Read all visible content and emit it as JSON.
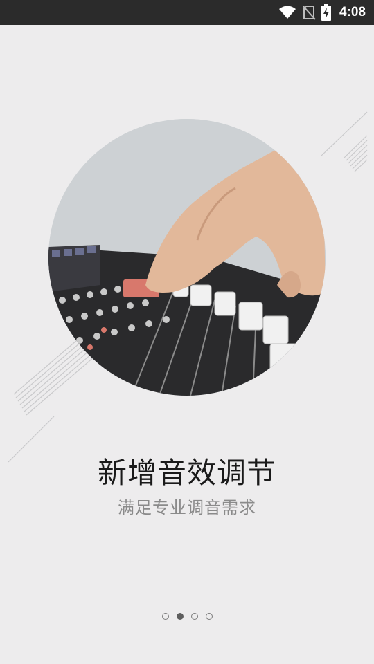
{
  "status_bar": {
    "time": "4:08",
    "icons": [
      "wifi-icon",
      "no-sim-icon",
      "battery-charging-icon"
    ]
  },
  "onboarding": {
    "image": "mixing-console-hand-photo",
    "title": "新增音效调节",
    "subtitle": "满足专业调音需求",
    "pager": {
      "pages": 4,
      "current_page": 2
    }
  },
  "colors": {
    "background": "#edeced",
    "status_bar": "#2b2b2b",
    "title": "#1a1a1a",
    "subtitle": "#8a8a8a",
    "fader_red": "#d8786c"
  }
}
